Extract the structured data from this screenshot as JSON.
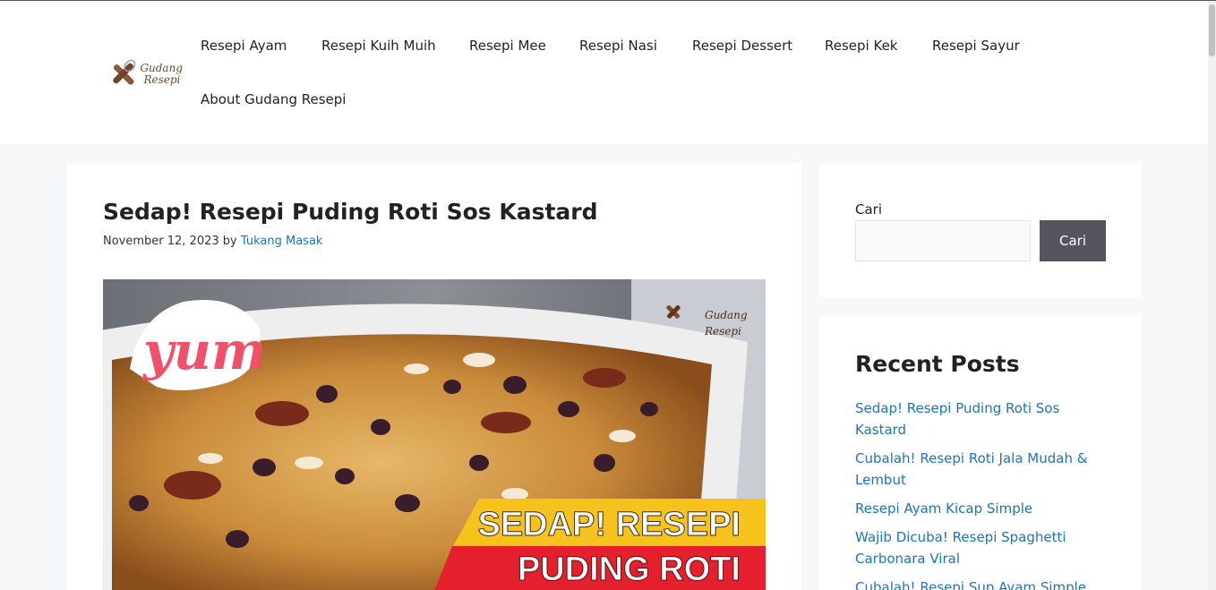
{
  "header": {
    "logo_text_line1": "Gudang",
    "logo_text_line2": "Resepi",
    "nav": [
      "Resepi Ayam",
      "Resepi Kuih Muih",
      "Resepi Mee",
      "Resepi Nasi",
      "Resepi Dessert",
      "Resepi Kek",
      "Resepi Sayur",
      "About Gudang Resepi"
    ]
  },
  "post": {
    "title": "Sedap! Resepi Puding Roti Sos Kastard",
    "date": "November 12, 2023",
    "by": "by",
    "author": "Tukang Masak",
    "image": {
      "sticker": "yum",
      "watermark_line1": "Gudang",
      "watermark_line2": "Resepi",
      "banner_line1": "SEDAP! RESEPI",
      "banner_line2": "PUDING ROTI"
    }
  },
  "sidebar": {
    "search": {
      "label": "Cari",
      "placeholder": "",
      "button": "Cari"
    },
    "recent": {
      "title": "Recent Posts",
      "items": [
        "Sedap! Resepi Puding Roti Sos Kastard",
        "Cubalah! Resepi Roti Jala Mudah & Lembut",
        "Resepi Ayam Kicap Simple",
        "Wajib Dicuba! Resepi Spaghetti Carbonara Viral",
        "Cubalah! Resepi Sup Ayam Simple"
      ]
    }
  },
  "colors": {
    "link": "#1e73be",
    "button": "#55555e",
    "page_bg": "#f7f8f9"
  }
}
